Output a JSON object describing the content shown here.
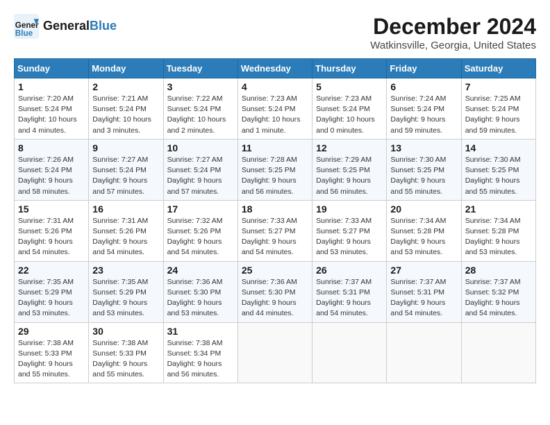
{
  "header": {
    "logo_line1": "General",
    "logo_line2": "Blue",
    "month": "December 2024",
    "location": "Watkinsville, Georgia, United States"
  },
  "weekdays": [
    "Sunday",
    "Monday",
    "Tuesday",
    "Wednesday",
    "Thursday",
    "Friday",
    "Saturday"
  ],
  "weeks": [
    [
      {
        "day": "1",
        "sunrise": "Sunrise: 7:20 AM",
        "sunset": "Sunset: 5:24 PM",
        "daylight": "Daylight: 10 hours and 4 minutes."
      },
      {
        "day": "2",
        "sunrise": "Sunrise: 7:21 AM",
        "sunset": "Sunset: 5:24 PM",
        "daylight": "Daylight: 10 hours and 3 minutes."
      },
      {
        "day": "3",
        "sunrise": "Sunrise: 7:22 AM",
        "sunset": "Sunset: 5:24 PM",
        "daylight": "Daylight: 10 hours and 2 minutes."
      },
      {
        "day": "4",
        "sunrise": "Sunrise: 7:23 AM",
        "sunset": "Sunset: 5:24 PM",
        "daylight": "Daylight: 10 hours and 1 minute."
      },
      {
        "day": "5",
        "sunrise": "Sunrise: 7:23 AM",
        "sunset": "Sunset: 5:24 PM",
        "daylight": "Daylight: 10 hours and 0 minutes."
      },
      {
        "day": "6",
        "sunrise": "Sunrise: 7:24 AM",
        "sunset": "Sunset: 5:24 PM",
        "daylight": "Daylight: 9 hours and 59 minutes."
      },
      {
        "day": "7",
        "sunrise": "Sunrise: 7:25 AM",
        "sunset": "Sunset: 5:24 PM",
        "daylight": "Daylight: 9 hours and 59 minutes."
      }
    ],
    [
      {
        "day": "8",
        "sunrise": "Sunrise: 7:26 AM",
        "sunset": "Sunset: 5:24 PM",
        "daylight": "Daylight: 9 hours and 58 minutes."
      },
      {
        "day": "9",
        "sunrise": "Sunrise: 7:27 AM",
        "sunset": "Sunset: 5:24 PM",
        "daylight": "Daylight: 9 hours and 57 minutes."
      },
      {
        "day": "10",
        "sunrise": "Sunrise: 7:27 AM",
        "sunset": "Sunset: 5:24 PM",
        "daylight": "Daylight: 9 hours and 57 minutes."
      },
      {
        "day": "11",
        "sunrise": "Sunrise: 7:28 AM",
        "sunset": "Sunset: 5:25 PM",
        "daylight": "Daylight: 9 hours and 56 minutes."
      },
      {
        "day": "12",
        "sunrise": "Sunrise: 7:29 AM",
        "sunset": "Sunset: 5:25 PM",
        "daylight": "Daylight: 9 hours and 56 minutes."
      },
      {
        "day": "13",
        "sunrise": "Sunrise: 7:30 AM",
        "sunset": "Sunset: 5:25 PM",
        "daylight": "Daylight: 9 hours and 55 minutes."
      },
      {
        "day": "14",
        "sunrise": "Sunrise: 7:30 AM",
        "sunset": "Sunset: 5:25 PM",
        "daylight": "Daylight: 9 hours and 55 minutes."
      }
    ],
    [
      {
        "day": "15",
        "sunrise": "Sunrise: 7:31 AM",
        "sunset": "Sunset: 5:26 PM",
        "daylight": "Daylight: 9 hours and 54 minutes."
      },
      {
        "day": "16",
        "sunrise": "Sunrise: 7:31 AM",
        "sunset": "Sunset: 5:26 PM",
        "daylight": "Daylight: 9 hours and 54 minutes."
      },
      {
        "day": "17",
        "sunrise": "Sunrise: 7:32 AM",
        "sunset": "Sunset: 5:26 PM",
        "daylight": "Daylight: 9 hours and 54 minutes."
      },
      {
        "day": "18",
        "sunrise": "Sunrise: 7:33 AM",
        "sunset": "Sunset: 5:27 PM",
        "daylight": "Daylight: 9 hours and 54 minutes."
      },
      {
        "day": "19",
        "sunrise": "Sunrise: 7:33 AM",
        "sunset": "Sunset: 5:27 PM",
        "daylight": "Daylight: 9 hours and 53 minutes."
      },
      {
        "day": "20",
        "sunrise": "Sunrise: 7:34 AM",
        "sunset": "Sunset: 5:28 PM",
        "daylight": "Daylight: 9 hours and 53 minutes."
      },
      {
        "day": "21",
        "sunrise": "Sunrise: 7:34 AM",
        "sunset": "Sunset: 5:28 PM",
        "daylight": "Daylight: 9 hours and 53 minutes."
      }
    ],
    [
      {
        "day": "22",
        "sunrise": "Sunrise: 7:35 AM",
        "sunset": "Sunset: 5:29 PM",
        "daylight": "Daylight: 9 hours and 53 minutes."
      },
      {
        "day": "23",
        "sunrise": "Sunrise: 7:35 AM",
        "sunset": "Sunset: 5:29 PM",
        "daylight": "Daylight: 9 hours and 53 minutes."
      },
      {
        "day": "24",
        "sunrise": "Sunrise: 7:36 AM",
        "sunset": "Sunset: 5:30 PM",
        "daylight": "Daylight: 9 hours and 53 minutes."
      },
      {
        "day": "25",
        "sunrise": "Sunrise: 7:36 AM",
        "sunset": "Sunset: 5:30 PM",
        "daylight": "Daylight: 9 hours and 44 minutes."
      },
      {
        "day": "26",
        "sunrise": "Sunrise: 7:37 AM",
        "sunset": "Sunset: 5:31 PM",
        "daylight": "Daylight: 9 hours and 54 minutes."
      },
      {
        "day": "27",
        "sunrise": "Sunrise: 7:37 AM",
        "sunset": "Sunset: 5:31 PM",
        "daylight": "Daylight: 9 hours and 54 minutes."
      },
      {
        "day": "28",
        "sunrise": "Sunrise: 7:37 AM",
        "sunset": "Sunset: 5:32 PM",
        "daylight": "Daylight: 9 hours and 54 minutes."
      }
    ],
    [
      {
        "day": "29",
        "sunrise": "Sunrise: 7:38 AM",
        "sunset": "Sunset: 5:33 PM",
        "daylight": "Daylight: 9 hours and 55 minutes."
      },
      {
        "day": "30",
        "sunrise": "Sunrise: 7:38 AM",
        "sunset": "Sunset: 5:33 PM",
        "daylight": "Daylight: 9 hours and 55 minutes."
      },
      {
        "day": "31",
        "sunrise": "Sunrise: 7:38 AM",
        "sunset": "Sunset: 5:34 PM",
        "daylight": "Daylight: 9 hours and 56 minutes."
      },
      null,
      null,
      null,
      null
    ]
  ]
}
